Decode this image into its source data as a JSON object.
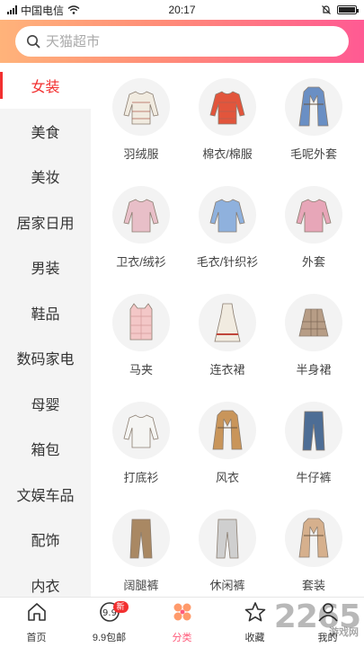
{
  "status_bar": {
    "carrier": "中国电信",
    "time": "20:17"
  },
  "search": {
    "placeholder": "天猫超市"
  },
  "sidebar": {
    "active_index": 0,
    "items": [
      {
        "label": "女装"
      },
      {
        "label": "美食"
      },
      {
        "label": "美妆"
      },
      {
        "label": "居家日用"
      },
      {
        "label": "男装"
      },
      {
        "label": "鞋品"
      },
      {
        "label": "数码家电"
      },
      {
        "label": "母婴"
      },
      {
        "label": "箱包"
      },
      {
        "label": "文娱车品"
      },
      {
        "label": "配饰"
      },
      {
        "label": "内衣"
      }
    ]
  },
  "categories": [
    {
      "label": "羽绒服",
      "icon": "down-jacket-icon",
      "color": "#f1ebe0"
    },
    {
      "label": "棉衣/棉服",
      "icon": "cotton-coat-icon",
      "color": "#e2553c"
    },
    {
      "label": "毛呢外套",
      "icon": "wool-coat-icon",
      "color": "#6a8fc4"
    },
    {
      "label": "卫衣/绒衫",
      "icon": "sweatshirt-icon",
      "color": "#e8bfc8"
    },
    {
      "label": "毛衣/针织衫",
      "icon": "sweater-icon",
      "color": "#8fb1dd"
    },
    {
      "label": "外套",
      "icon": "jacket-icon",
      "color": "#e7a6b8"
    },
    {
      "label": "马夹",
      "icon": "vest-icon",
      "color": "#f3c7c7"
    },
    {
      "label": "连衣裙",
      "icon": "dress-icon",
      "color": "#f1ebe0"
    },
    {
      "label": "半身裙",
      "icon": "skirt-icon",
      "color": "#b79d86"
    },
    {
      "label": "打底衫",
      "icon": "turtleneck-icon",
      "color": "#f5f5f3"
    },
    {
      "label": "风衣",
      "icon": "trench-coat-icon",
      "color": "#c9955a"
    },
    {
      "label": "牛仔裤",
      "icon": "jeans-icon",
      "color": "#4d6d95"
    },
    {
      "label": "阔腿裤",
      "icon": "wide-pants-icon",
      "color": "#a98863"
    },
    {
      "label": "休闲裤",
      "icon": "casual-pants-icon",
      "color": "#cfcfcf"
    },
    {
      "label": "套装",
      "icon": "suit-set-icon",
      "color": "#d6b08d"
    }
  ],
  "tabbar": {
    "items": [
      {
        "label": "首页",
        "icon": "home-icon"
      },
      {
        "label": "9.9包邮",
        "icon": "ninety-nine-icon",
        "badge": "新"
      },
      {
        "label": "分类",
        "icon": "category-icon"
      },
      {
        "label": "收藏",
        "icon": "star-icon"
      },
      {
        "label": "我的",
        "icon": "user-icon"
      }
    ],
    "active_index": 2
  },
  "watermark": {
    "text": "2265",
    "sub": "游戏网"
  },
  "colors": {
    "accent": "#f23030",
    "header_start": "#ffb37a",
    "header_end": "#ff5a93",
    "tab_active": "#ff5a7a"
  }
}
